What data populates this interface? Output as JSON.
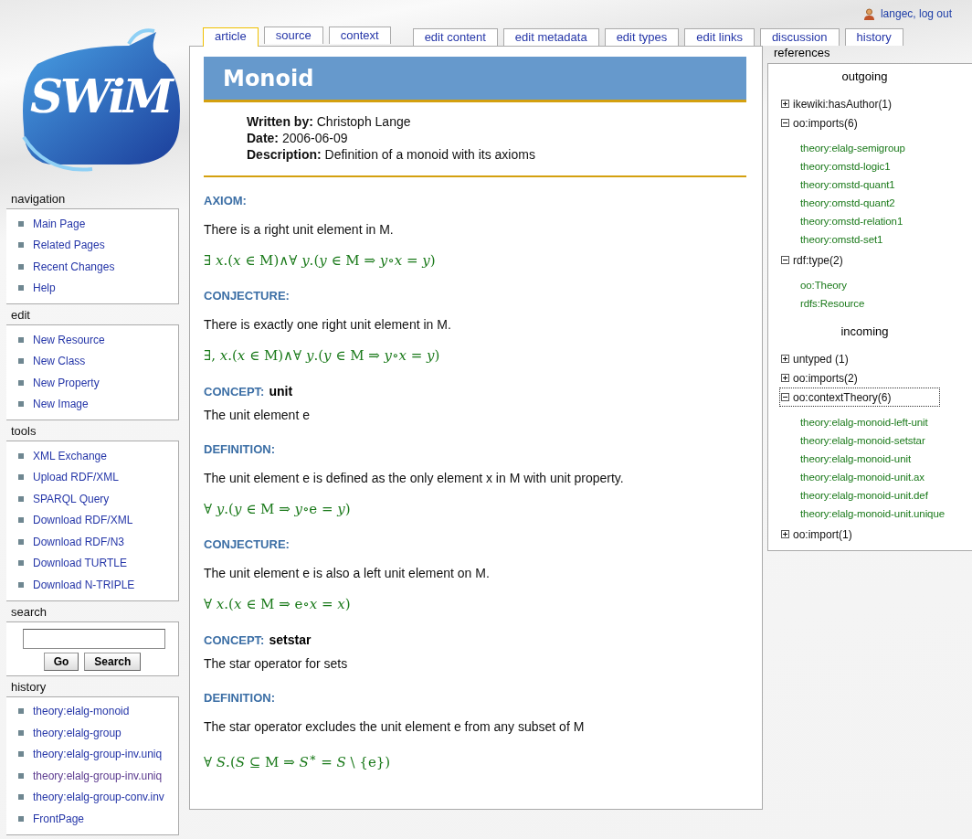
{
  "user": {
    "text": "langec, log out"
  },
  "logo": {
    "text": "SWiM"
  },
  "sidebar": [
    {
      "title": "navigation",
      "items": [
        {
          "label": "Main Page",
          "visited": false
        },
        {
          "label": "Related Pages",
          "visited": false
        },
        {
          "label": "Recent Changes",
          "visited": false
        },
        {
          "label": "Help",
          "visited": false
        }
      ]
    },
    {
      "title": "edit",
      "items": [
        {
          "label": "New Resource",
          "visited": false
        },
        {
          "label": "New Class",
          "visited": false
        },
        {
          "label": "New Property",
          "visited": false
        },
        {
          "label": "New Image",
          "visited": false
        }
      ]
    },
    {
      "title": "tools",
      "items": [
        {
          "label": "XML Exchange",
          "visited": false
        },
        {
          "label": "Upload RDF/XML",
          "visited": false
        },
        {
          "label": "SPARQL Query",
          "visited": false
        },
        {
          "label": "Download RDF/XML",
          "visited": false
        },
        {
          "label": "Download RDF/N3",
          "visited": false
        },
        {
          "label": "Download TURTLE",
          "visited": false
        },
        {
          "label": "Download N-TRIPLE",
          "visited": false
        }
      ]
    },
    {
      "title": "search",
      "search": {
        "buttons": [
          "Go",
          "Search"
        ]
      }
    },
    {
      "title": "history",
      "items": [
        {
          "label": "theory:elalg-monoid",
          "visited": false
        },
        {
          "label": "theory:elalg-group",
          "visited": false
        },
        {
          "label": "theory:elalg-group-inv.uniq",
          "visited": false
        },
        {
          "label": "theory:elalg-group-inv.uniq",
          "visited": true
        },
        {
          "label": "theory:elalg-group-conv.inv",
          "visited": false
        },
        {
          "label": "FrontPage",
          "visited": false
        }
      ]
    }
  ],
  "tab_groups": [
    {
      "tabs": [
        {
          "label": "article",
          "selected": true
        },
        {
          "label": "source",
          "selected": false
        },
        {
          "label": "context",
          "selected": false
        }
      ]
    },
    {
      "tabs": [
        {
          "label": "edit content",
          "selected": false
        },
        {
          "label": "edit metadata",
          "selected": false
        },
        {
          "label": "edit types",
          "selected": false
        },
        {
          "label": "edit links",
          "selected": false
        },
        {
          "label": "discussion",
          "selected": false
        },
        {
          "label": "history",
          "selected": false
        }
      ]
    }
  ],
  "article": {
    "title": "Monoid",
    "meta": [
      "**Written by:** Christoph Lange",
      "**Date:** 2006-06-09",
      "**Description:** Definition of a monoid with its axioms"
    ],
    "blocks": [
      {
        "kind": "statement",
        "label": "AXIOM:",
        "text": "There is a right unit element in M.",
        "formula": "∃ *x*.(*x* ∈ M)∧∀ *y*.(*y* ∈ M ⇒ *y*∘*x* = *y*)"
      },
      {
        "kind": "statement",
        "label": "CONJECTURE:",
        "text": "There is exactly one right unit element in M.",
        "formula": "∃, *x*.(*x* ∈ M)∧∀ *y*.(*y* ∈ M ⇒ *y*∘*x* = *y*)"
      },
      {
        "kind": "concept",
        "label": "CONCEPT:",
        "term": "unit",
        "text": "The unit element e"
      },
      {
        "kind": "statement",
        "label": "DEFINITION:",
        "text": "The unit element e is defined as the only element x in M with unit property.",
        "formula": "∀ *y*.(*y* ∈ M ⇒ *y*∘e = *y*)"
      },
      {
        "kind": "statement",
        "label": "CONJECTURE:",
        "text": "The unit element e is also a left unit element on M.",
        "formula": "∀ *x*.(*x* ∈ M ⇒ e∘*x* = *x*)"
      },
      {
        "kind": "concept",
        "label": "CONCEPT:",
        "term": "setstar",
        "text": "The star operator for sets"
      },
      {
        "kind": "statement",
        "label": "DEFINITION:",
        "text": "The star operator excludes the unit element e from any subset of M",
        "formula": "∀ *S*.(*S* ⊆ M ⇒ *S*$^{∗}$ = *S* \\ {e})"
      }
    ]
  },
  "references": {
    "title": "references",
    "sections": [
      {
        "title": "outgoing",
        "groups": [
          {
            "label": "ikewiki:hasAuthor(1)",
            "expanded": false,
            "selected": false
          },
          {
            "label": "oo:imports(6)",
            "expanded": true,
            "selected": false,
            "children": [
              "theory:elalg-semigroup",
              "theory:omstd-logic1",
              "theory:omstd-quant1",
              "theory:omstd-quant2",
              "theory:omstd-relation1",
              "theory:omstd-set1"
            ]
          },
          {
            "label": "rdf:type(2)",
            "expanded": true,
            "selected": false,
            "children": [
              "oo:Theory",
              "rdfs:Resource"
            ]
          }
        ]
      },
      {
        "title": "incoming",
        "groups": [
          {
            "label": "untyped (1)",
            "expanded": false,
            "selected": false
          },
          {
            "label": "oo:imports(2)",
            "expanded": false,
            "selected": false
          },
          {
            "label": "oo:contextTheory(6)",
            "expanded": true,
            "selected": true,
            "children": [
              "theory:elalg-monoid-left-unit",
              "theory:elalg-monoid-setstar",
              "theory:elalg-monoid-unit",
              "theory:elalg-monoid-unit.ax",
              "theory:elalg-monoid-unit.def",
              "theory:elalg-monoid-unit.unique"
            ]
          },
          {
            "label": "oo:import(1)",
            "expanded": false,
            "selected": false
          }
        ]
      }
    ]
  }
}
